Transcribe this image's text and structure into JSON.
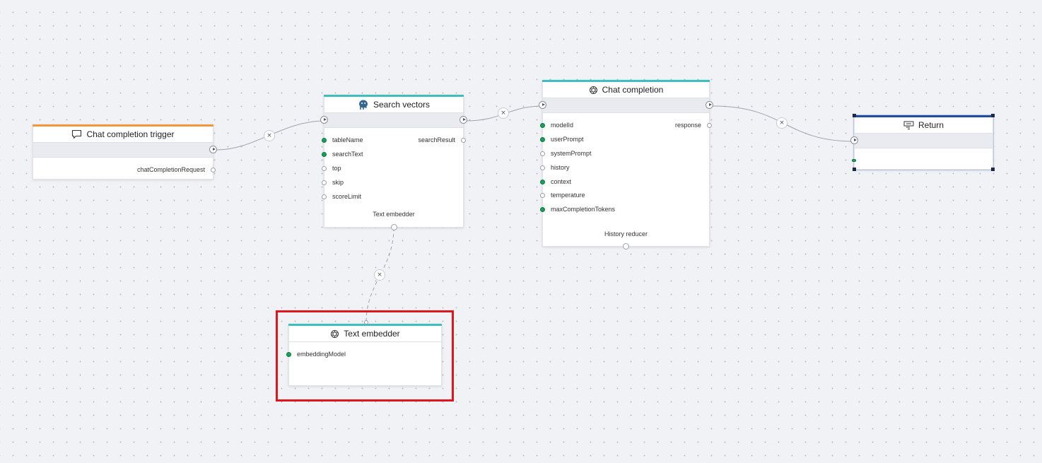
{
  "canvas": {
    "edge_delete_glyph": "×",
    "highlight_color": "#e0161e"
  },
  "nodes": {
    "trigger": {
      "title": "Chat completion trigger",
      "icon": "chat-bubble-icon",
      "accent": "#f0963c",
      "outputs": [
        "chatCompletionRequest"
      ]
    },
    "search": {
      "title": "Search vectors",
      "icon": "postgresql-elephant-icon",
      "accent": "#3dbfbf",
      "inputs": [
        "tableName",
        "searchText",
        "top",
        "skip",
        "scoreLimit"
      ],
      "input_connected": [
        true,
        true,
        false,
        false,
        false
      ],
      "outputs": [
        "searchResult"
      ],
      "dependency": "Text embedder"
    },
    "chat": {
      "title": "Chat completion",
      "icon": "openai-icon",
      "accent": "#3dbfbf",
      "inputs": [
        "modelId",
        "userPrompt",
        "systemPrompt",
        "history",
        "context",
        "temperature",
        "maxCompletionTokens"
      ],
      "input_connected": [
        true,
        true,
        false,
        false,
        true,
        false,
        true
      ],
      "outputs": [
        "response"
      ],
      "dependency": "History reducer"
    },
    "ret": {
      "title": "Return",
      "icon": "return-icon",
      "accent": "#1e4f9c",
      "selected": true
    },
    "embedder": {
      "title": "Text embedder",
      "icon": "openai-icon",
      "accent": "#3dbfbf",
      "inputs": [
        "embeddingModel"
      ],
      "input_connected": [
        true
      ]
    }
  }
}
